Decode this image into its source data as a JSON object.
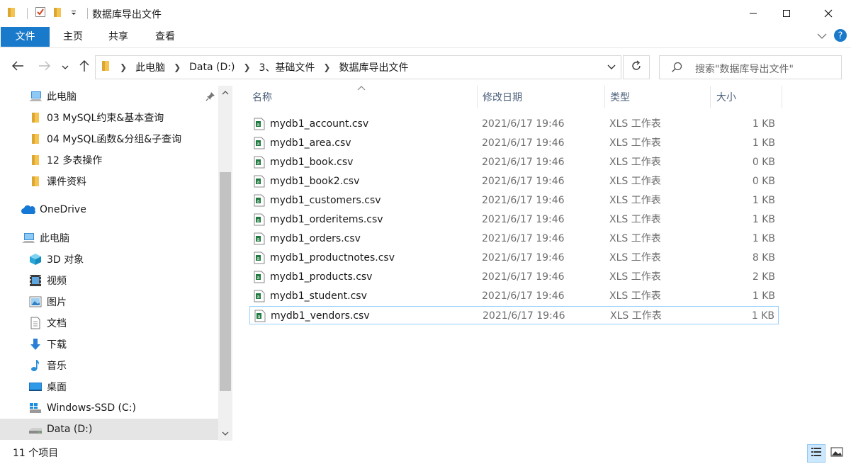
{
  "window": {
    "title": "数据库导出文件"
  },
  "ribbon": {
    "tabs": [
      "文件",
      "主页",
      "共享",
      "查看"
    ]
  },
  "address": {
    "crumbs": [
      "此电脑",
      "Data (D:)",
      "3、基础文件",
      "数据库导出文件"
    ]
  },
  "search": {
    "placeholder": "搜索\"数据库导出文件\""
  },
  "nav": {
    "items": [
      {
        "label": "此电脑",
        "icon": "pc-icon"
      },
      {
        "label": "03 MySQL约束&基本查询",
        "icon": "folder-icon"
      },
      {
        "label": "04 MySQL函数&分组&子查询",
        "icon": "folder-icon"
      },
      {
        "label": "12 多表操作",
        "icon": "folder-icon"
      },
      {
        "label": "课件资料",
        "icon": "folder-icon"
      },
      {
        "label": "OneDrive",
        "icon": "onedrive-icon"
      },
      {
        "label": "此电脑",
        "icon": "pc-icon"
      },
      {
        "label": "3D 对象",
        "icon": "3d-objects-icon"
      },
      {
        "label": "视频",
        "icon": "video-icon"
      },
      {
        "label": "图片",
        "icon": "pictures-icon"
      },
      {
        "label": "文档",
        "icon": "documents-icon"
      },
      {
        "label": "下载",
        "icon": "download-icon"
      },
      {
        "label": "音乐",
        "icon": "music-icon"
      },
      {
        "label": "桌面",
        "icon": "desktop-icon"
      },
      {
        "label": "Windows-SSD (C:)",
        "icon": "windows-drive-icon"
      },
      {
        "label": "Data (D:)",
        "icon": "drive-icon"
      }
    ]
  },
  "columns": {
    "name": "名称",
    "date": "修改日期",
    "type": "类型",
    "size": "大小"
  },
  "files": [
    {
      "name": "mydb1_account.csv",
      "date": "2021/6/17 19:46",
      "type": "XLS 工作表",
      "size": "1 KB"
    },
    {
      "name": "mydb1_area.csv",
      "date": "2021/6/17 19:46",
      "type": "XLS 工作表",
      "size": "1 KB"
    },
    {
      "name": "mydb1_book.csv",
      "date": "2021/6/17 19:46",
      "type": "XLS 工作表",
      "size": "0 KB"
    },
    {
      "name": "mydb1_book2.csv",
      "date": "2021/6/17 19:46",
      "type": "XLS 工作表",
      "size": "0 KB"
    },
    {
      "name": "mydb1_customers.csv",
      "date": "2021/6/17 19:46",
      "type": "XLS 工作表",
      "size": "1 KB"
    },
    {
      "name": "mydb1_orderitems.csv",
      "date": "2021/6/17 19:46",
      "type": "XLS 工作表",
      "size": "1 KB"
    },
    {
      "name": "mydb1_orders.csv",
      "date": "2021/6/17 19:46",
      "type": "XLS 工作表",
      "size": "1 KB"
    },
    {
      "name": "mydb1_productnotes.csv",
      "date": "2021/6/17 19:46",
      "type": "XLS 工作表",
      "size": "8 KB"
    },
    {
      "name": "mydb1_products.csv",
      "date": "2021/6/17 19:46",
      "type": "XLS 工作表",
      "size": "2 KB"
    },
    {
      "name": "mydb1_student.csv",
      "date": "2021/6/17 19:46",
      "type": "XLS 工作表",
      "size": "1 KB"
    },
    {
      "name": "mydb1_vendors.csv",
      "date": "2021/6/17 19:46",
      "type": "XLS 工作表",
      "size": "1 KB"
    }
  ],
  "status": {
    "count_text": "11 个项目"
  },
  "colors": {
    "accent": "#1979ca",
    "folder": "#f4c453",
    "excel_green": "#1f7a3f"
  }
}
